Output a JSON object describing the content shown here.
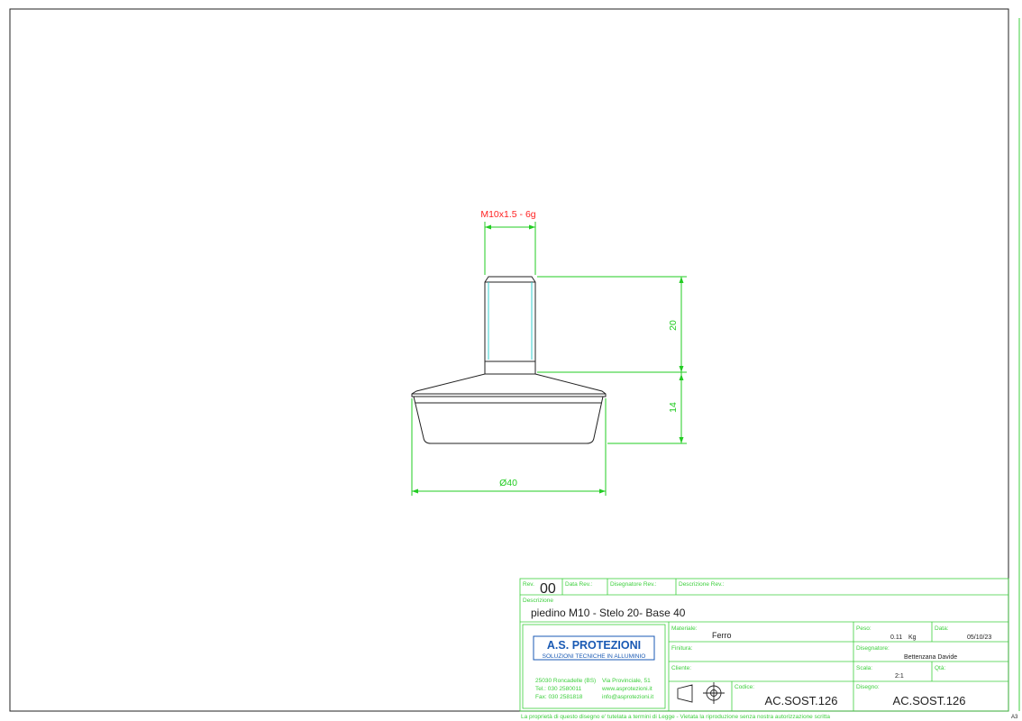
{
  "colors": {
    "frame": "#222222",
    "dimension": "#22cc22",
    "thread_label": "#ff2222",
    "hidden_thread": "#33cccc",
    "title_block": "#3ccf3c",
    "logo_blue": "#1a5ab4"
  },
  "drawing": {
    "thread_callout": "M10x1.5 - 6g",
    "dim_stem": "20",
    "dim_base": "14",
    "dim_diameter": "Ø40"
  },
  "title_block": {
    "rev_label": "Rev.",
    "rev_value": "00",
    "data_rev_label": "Data Rev.:",
    "disegnatore_rev_label": "Disegnatore Rev.:",
    "descrizione_rev_label": "Descrizione Rev.:",
    "descrizione_label": "Descrizione",
    "descrizione_value": "piedino M10 - Stelo 20- Base 40",
    "company_name": "A.S. PROTEZIONI",
    "company_tagline": "SOLUZIONI TECNICHE IN ALLUMINIO",
    "company_address_1": "25030 Roncadelle (BS)",
    "company_address_2": "Via Provinciale, 51",
    "company_tel": "Tel.: 030 2580011",
    "company_web": "www.asprotezioni.it",
    "company_fax": "Fax: 030 2581818",
    "company_email": "info@asprotezioni.it",
    "materiale_label": "Materiale:",
    "materiale_value": "Ferro",
    "finitura_label": "Finitura:",
    "cliente_label": "Cliente:",
    "codice_label": "Codice:",
    "codice_value": "AC.SOST.126",
    "peso_label": "Peso:",
    "peso_value": "0.11",
    "peso_unit": "Kg",
    "data_label": "Data:",
    "data_value": "05/10/23",
    "disegnatore_label": "Disegnatore:",
    "disegnatore_value": "Bettenzana Davide",
    "scala_label": "Scala:",
    "scala_value": "2:1",
    "qta_label": "Qtà:",
    "disegno_label": "Disegno:",
    "disegno_value": "AC.SOST.126",
    "footer_note": "La proprietà di questo disegno e' tutelata a termini di Legge - Vietata la riproduzione senza nostra autorizzazione scritta",
    "sheet_size": "A3"
  }
}
